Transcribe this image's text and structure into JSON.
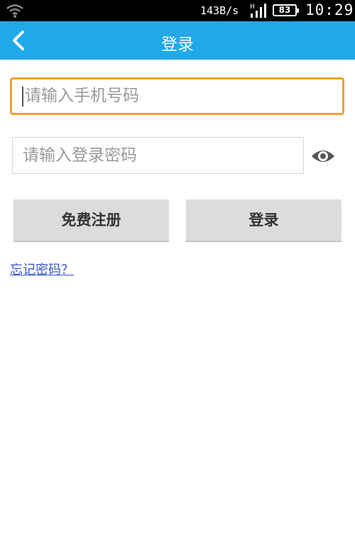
{
  "status_bar": {
    "speed": "143B/s",
    "network": "H",
    "battery": "83",
    "time": "10:29"
  },
  "header": {
    "title": "登录",
    "back_icon": "chevron-left-icon"
  },
  "form": {
    "phone_placeholder": "请输入手机号码",
    "password_placeholder": "请输入登录密码",
    "eye_icon": "eye-icon",
    "register_label": "免费注册",
    "login_label": "登录",
    "forgot_label": "忘记密码？"
  },
  "colors": {
    "header_bg": "#1fa9e8",
    "focus_border": "#f0a030",
    "button_bg": "#dcdcdc",
    "link": "#3355cc"
  }
}
